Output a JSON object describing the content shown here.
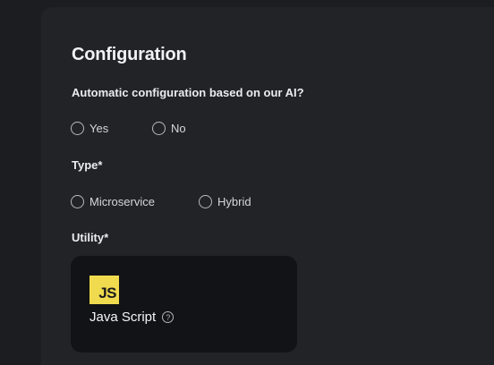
{
  "form": {
    "title": "Configuration",
    "auto_config": {
      "question": "Automatic configuration based on our AI?",
      "options": [
        "Yes",
        "No"
      ]
    },
    "type": {
      "label": "Type*",
      "options": [
        "Microservice",
        "Hybrid"
      ]
    },
    "utility": {
      "label": "Utility*",
      "card": {
        "logo_text": "JS",
        "name": "Java Script",
        "icon": "help-circle-icon",
        "logo_color": "#f0db4f"
      }
    }
  }
}
